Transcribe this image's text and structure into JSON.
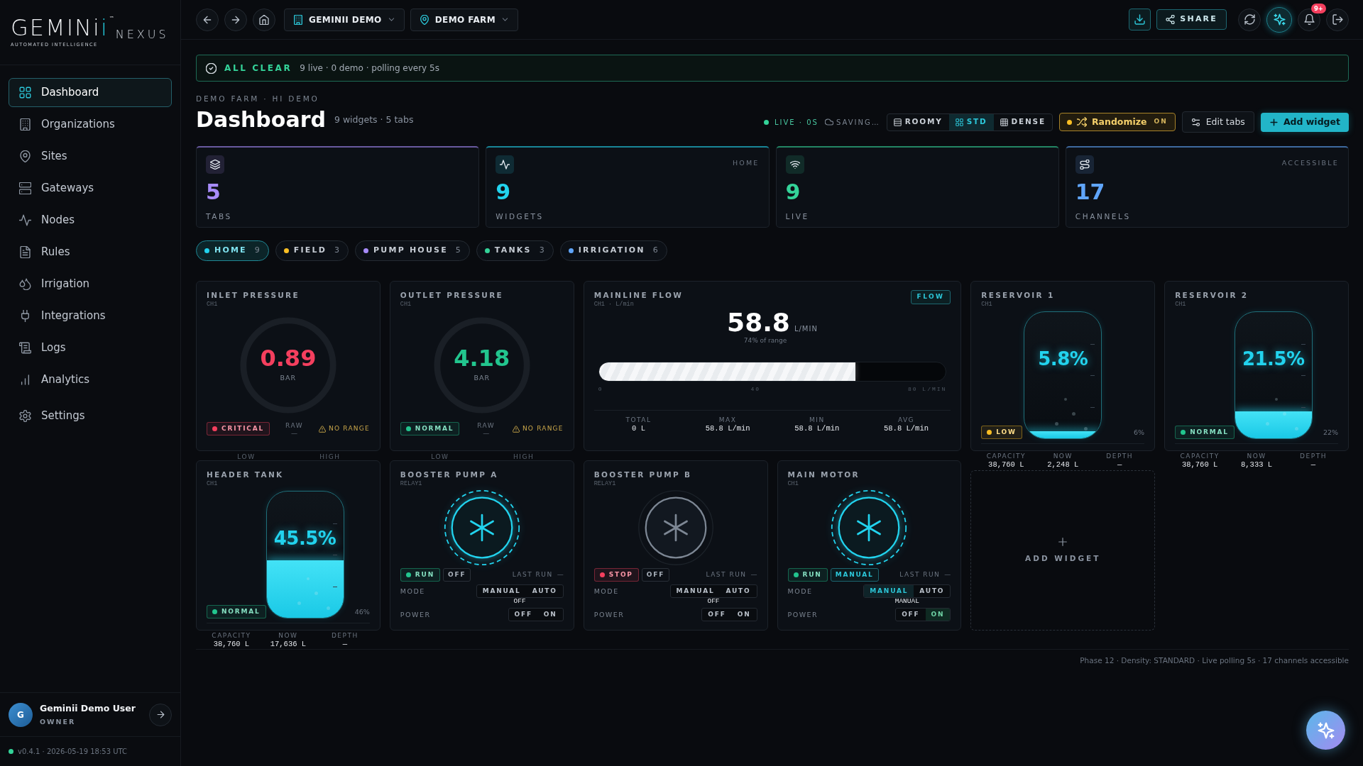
{
  "sidebar": {
    "logo": {
      "wordmark": "GEMINii",
      "mark": "™",
      "product": "NEXUS",
      "tagline": "AUTOMATED INTELLIGENCE"
    },
    "items": [
      {
        "label": "Dashboard",
        "selected": true
      },
      {
        "label": "Organizations",
        "selected": false
      },
      {
        "label": "Sites",
        "selected": false
      },
      {
        "label": "Gateways",
        "selected": false
      },
      {
        "label": "Nodes",
        "selected": false
      },
      {
        "label": "Rules",
        "selected": false
      },
      {
        "label": "Irrigation",
        "selected": false
      },
      {
        "label": "Integrations",
        "selected": false
      },
      {
        "label": "Logs",
        "selected": false
      },
      {
        "label": "Analytics",
        "selected": false
      }
    ],
    "footer_items": [
      {
        "label": "Settings",
        "selected": false
      }
    ],
    "user": {
      "initial": "G",
      "name": "Geminii Demo User",
      "role": "OWNER"
    },
    "version": "v0.4.1 · 2026-05-19 18:53 UTC"
  },
  "topbar": {
    "org": "GEMINII DEMO",
    "site": "DEMO FARM",
    "share": "SHARE",
    "assistant_open": true,
    "notification_count": "9+"
  },
  "alert": {
    "title": "ALL CLEAR",
    "detail": "9 live · 0 demo · polling every 5s"
  },
  "header": {
    "breadcrumb": "DEMO FARM · HI DEMO",
    "title": "Dashboard",
    "summary": "9 widgets · 5 tabs",
    "live": "LIVE · 0S",
    "saving": "SAVING…",
    "densities": [
      {
        "label": "ROOMY",
        "selected": false
      },
      {
        "label": "STD",
        "selected": true
      },
      {
        "label": "DENSE",
        "selected": false
      }
    ],
    "randomize": {
      "label": "Randomize",
      "state": "ON",
      "on": true
    },
    "edit_tabs": "Edit tabs",
    "add_widget": "Add widget"
  },
  "stats": [
    {
      "value": "5",
      "label": "TABS",
      "color": "#a78bfa"
    },
    {
      "value": "9",
      "label": "WIDGETS",
      "tag": "HOME",
      "color": "#22d3ee"
    },
    {
      "value": "9",
      "label": "LIVE",
      "color": "#34d399"
    },
    {
      "value": "17",
      "label": "CHANNELS",
      "tag": "ACCESSIBLE",
      "color": "#60a5fa"
    }
  ],
  "tabs": [
    {
      "label": "HOME",
      "count": "9",
      "color": "#22d3ee",
      "selected": true
    },
    {
      "label": "FIELD",
      "count": "3",
      "color": "#fbbf24",
      "selected": false
    },
    {
      "label": "PUMP HOUSE",
      "count": "5",
      "color": "#a78bfa",
      "selected": false
    },
    {
      "label": "TANKS",
      "count": "3",
      "color": "#34d399",
      "selected": false
    },
    {
      "label": "IRRIGATION",
      "count": "6",
      "color": "#60a5fa",
      "selected": false
    }
  ],
  "widgets": [
    {
      "kind": "gauge",
      "title": "INLET PRESSURE",
      "channel": "CH1",
      "value": "0.89",
      "unit": "BAR",
      "status": "CRITICAL",
      "color": "#f43f5e",
      "raw": {
        "label": "RAW",
        "value": "—"
      },
      "warning": "NO RANGE",
      "range_labels": [
        "LOW",
        "HIGH"
      ]
    },
    {
      "kind": "gauge",
      "title": "OUTLET PRESSURE",
      "channel": "CH1",
      "value": "4.18",
      "unit": "BAR",
      "status": "NORMAL",
      "color": "#22c58e",
      "raw": {
        "label": "RAW",
        "value": "—"
      },
      "warning": "NO RANGE",
      "range_labels": [
        "LOW",
        "HIGH"
      ]
    },
    {
      "kind": "flow",
      "title": "MAINLINE FLOW",
      "channel": "CH1 · L/min",
      "tag": "FLOW",
      "value": "58.8",
      "unit": "L/MIN",
      "note": "74% of range",
      "level": 0.74,
      "ticks": [
        "0",
        "40",
        "80 L/MIN"
      ],
      "stats": [
        {
          "label": "TOTAL",
          "value": "0 L"
        },
        {
          "label": "MAX",
          "value": "58.8 L/min"
        },
        {
          "label": "MIN",
          "value": "58.8 L/min"
        },
        {
          "label": "AVG",
          "value": "58.8 L/min"
        }
      ]
    },
    {
      "kind": "tank",
      "title": "RESERVOIR 1",
      "channel": "CH1",
      "percent": "5.8%",
      "level": 0.058,
      "status": "LOW",
      "color": "#fbbf24",
      "rounded": "6%",
      "stats": [
        {
          "label": "CAPACITY",
          "value": "38,760 L"
        },
        {
          "label": "NOW",
          "value": "2,248 L"
        },
        {
          "label": "DEPTH",
          "value": "—"
        }
      ]
    },
    {
      "kind": "tank",
      "title": "RESERVOIR 2",
      "channel": "CH1",
      "percent": "21.5%",
      "level": 0.215,
      "status": "NORMAL",
      "color": "#22c58e",
      "rounded": "22%",
      "stats": [
        {
          "label": "CAPACITY",
          "value": "38,760 L"
        },
        {
          "label": "NOW",
          "value": "8,333 L"
        },
        {
          "label": "DEPTH",
          "value": "—"
        }
      ]
    },
    {
      "kind": "tank",
      "title": "HEADER TANK",
      "channel": "CH1",
      "percent": "45.5%",
      "level": 0.455,
      "status": "NORMAL",
      "color": "#22c58e",
      "rounded": "46%",
      "stats": [
        {
          "label": "CAPACITY",
          "value": "38,760 L"
        },
        {
          "label": "NOW",
          "value": "17,636 L"
        },
        {
          "label": "DEPTH",
          "value": "—"
        }
      ]
    },
    {
      "kind": "pump",
      "title": "BOOSTER PUMP A",
      "channel": "RELAY1",
      "running": true,
      "run_status": "RUN",
      "mode_badge": {
        "label": "OFF",
        "active": false
      },
      "last_run": {
        "label": "LAST RUN",
        "value": "—"
      },
      "mode": {
        "label": "MODE",
        "options": [
          {
            "label": "MANUAL",
            "selected": false
          },
          {
            "label": "AUTO",
            "selected": false
          }
        ],
        "value": "OFF"
      },
      "power": {
        "label": "POWER",
        "options": [
          {
            "label": "OFF",
            "selected": false
          },
          {
            "label": "ON",
            "selected": false
          }
        ]
      }
    },
    {
      "kind": "pump",
      "title": "BOOSTER PUMP B",
      "channel": "RELAY1",
      "running": false,
      "run_status": "STOP",
      "mode_badge": {
        "label": "OFF",
        "active": false
      },
      "last_run": {
        "label": "LAST RUN",
        "value": "—"
      },
      "mode": {
        "label": "MODE",
        "options": [
          {
            "label": "MANUAL",
            "selected": false
          },
          {
            "label": "AUTO",
            "selected": false
          }
        ],
        "value": "OFF"
      },
      "power": {
        "label": "POWER",
        "options": [
          {
            "label": "OFF",
            "selected": false
          },
          {
            "label": "ON",
            "selected": false
          }
        ]
      }
    },
    {
      "kind": "pump",
      "title": "MAIN MOTOR",
      "channel": "CH1",
      "running": true,
      "run_status": "RUN",
      "mode_badge": {
        "label": "MANUAL",
        "active": true
      },
      "last_run": {
        "label": "LAST RUN",
        "value": "—"
      },
      "mode": {
        "label": "MODE",
        "options": [
          {
            "label": "MANUAL",
            "selected": true
          },
          {
            "label": "AUTO",
            "selected": false
          }
        ],
        "value": "MANUAL"
      },
      "power": {
        "label": "POWER",
        "options": [
          {
            "label": "OFF",
            "selected": false
          },
          {
            "label": "ON",
            "selected": true
          }
        ]
      }
    },
    {
      "kind": "add",
      "label": "ADD WIDGET"
    }
  ],
  "footer": "Phase 12 · Density: STANDARD · Live polling 5s · 17 channels accessible"
}
